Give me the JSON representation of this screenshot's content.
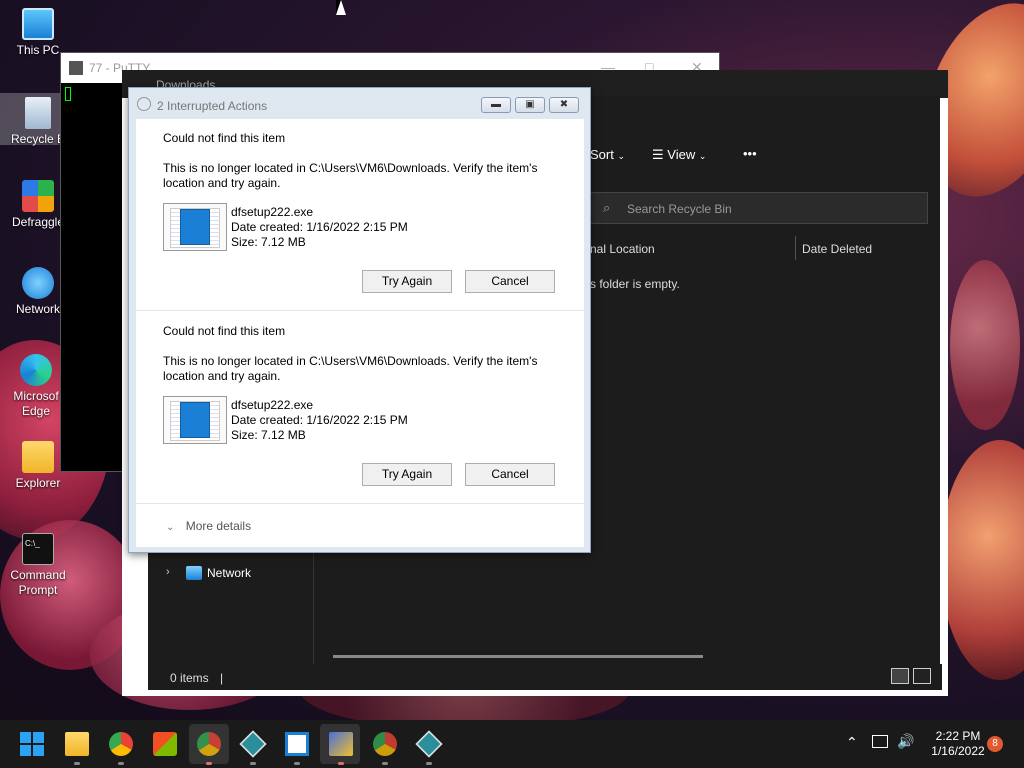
{
  "desktop_icons": [
    {
      "label": "This PC",
      "icon": "monitor-icon"
    },
    {
      "label": "Recycle B",
      "icon": "recycle-bin-icon"
    },
    {
      "label": "Defraggle",
      "icon": "defraggler-icon"
    },
    {
      "label": "Network",
      "icon": "network-icon"
    },
    {
      "label": "Microsof Edge",
      "icon": "edge-icon"
    },
    {
      "label": "Explorer",
      "icon": "folder-icon"
    },
    {
      "label": "Command Prompt",
      "icon": "cmd-icon"
    }
  ],
  "putty": {
    "title": "77 - PuTTY"
  },
  "explorer": {
    "title": "Downloads",
    "toolbar": {
      "sort": "Sort",
      "view": "View",
      "more": "•••"
    },
    "search_placeholder": "Search Recycle Bin",
    "columns": [
      "nal Location",
      "Date Deleted"
    ],
    "empty_message": "s folder is empty.",
    "nav_item": "Network",
    "status": "0 items"
  },
  "dialog": {
    "title": "2 Interrupted Actions",
    "items": [
      {
        "heading": "Could not find this item",
        "message": "This is no longer located in C:\\Users\\VM6\\Downloads. Verify the item's location and try again.",
        "filename": "dfsetup222.exe",
        "date": "Date created: 1/16/2022 2:15 PM",
        "size": "Size: 7.12 MB",
        "try_again": "Try Again",
        "cancel": "Cancel"
      },
      {
        "heading": "Could not find this item",
        "message": "This is no longer located in C:\\Users\\VM6\\Downloads. Verify the item's location and try again.",
        "filename": "dfsetup222.exe",
        "date": "Date created: 1/16/2022 2:15 PM",
        "size": "Size: 7.12 MB",
        "try_again": "Try Again",
        "cancel": "Cancel"
      }
    ],
    "more_details": "More details"
  },
  "taskbar": {
    "time": "2:22 PM",
    "date": "1/16/2022",
    "notifications": "8"
  },
  "colors": {
    "taskbar": "#1a1a1a",
    "explorer_bg": "#1c1c1c",
    "dialog_frame": "#dfe7f1",
    "accent": "#1b7fd6"
  }
}
